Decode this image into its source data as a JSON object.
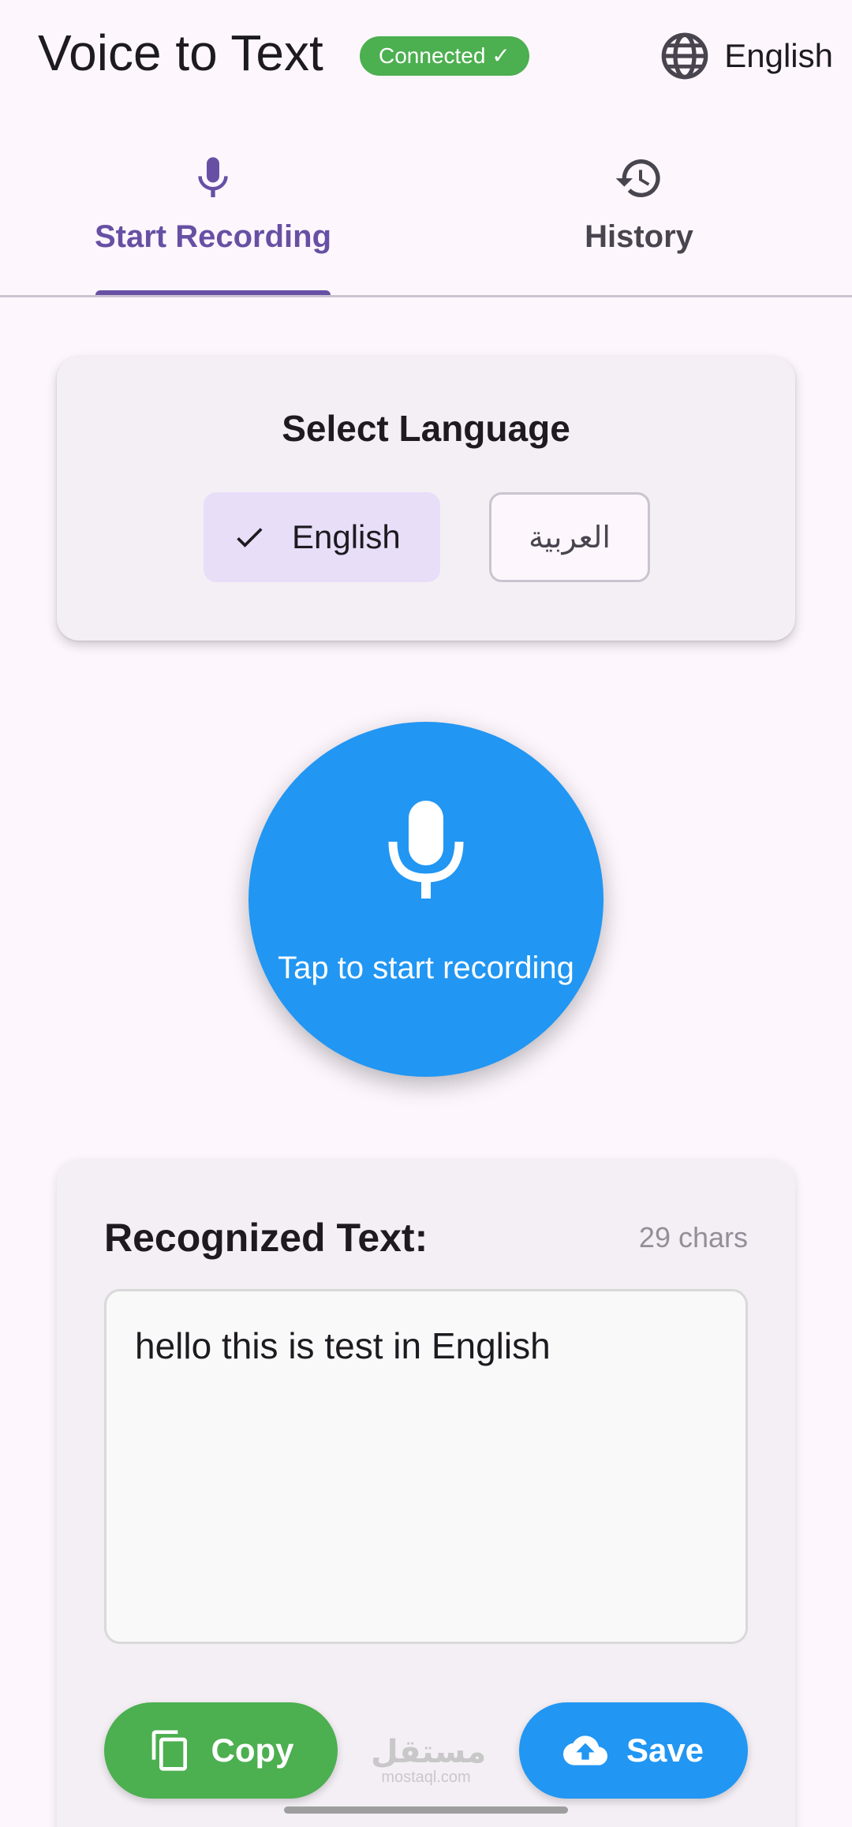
{
  "appbar": {
    "title": "Voice to Text",
    "status": "Connected ✓",
    "language_button": {
      "label": "English",
      "icon": "globe-icon"
    }
  },
  "tabs": [
    {
      "label": "Start Recording",
      "icon": "mic-icon",
      "selected": true
    },
    {
      "label": "History",
      "icon": "history-icon",
      "selected": false
    }
  ],
  "language_card": {
    "title": "Select Language",
    "options": [
      {
        "label": "English",
        "selected": true
      },
      {
        "label": "العربية",
        "selected": false
      }
    ]
  },
  "record_button": {
    "label": "Tap to start recording",
    "icon": "mic-icon"
  },
  "result_card": {
    "title": "Recognized Text:",
    "char_count": "29 chars",
    "text": "hello this is test in English",
    "copy_label": "Copy",
    "save_label": "Save"
  },
  "watermark": {
    "main": "مستقل",
    "sub": "mostaql.com"
  },
  "colors": {
    "primary": "#6750a4",
    "success": "#4caf50",
    "accent_blue": "#2196f3",
    "background": "#fdf7fd",
    "chip_selected": "#e8def8"
  }
}
